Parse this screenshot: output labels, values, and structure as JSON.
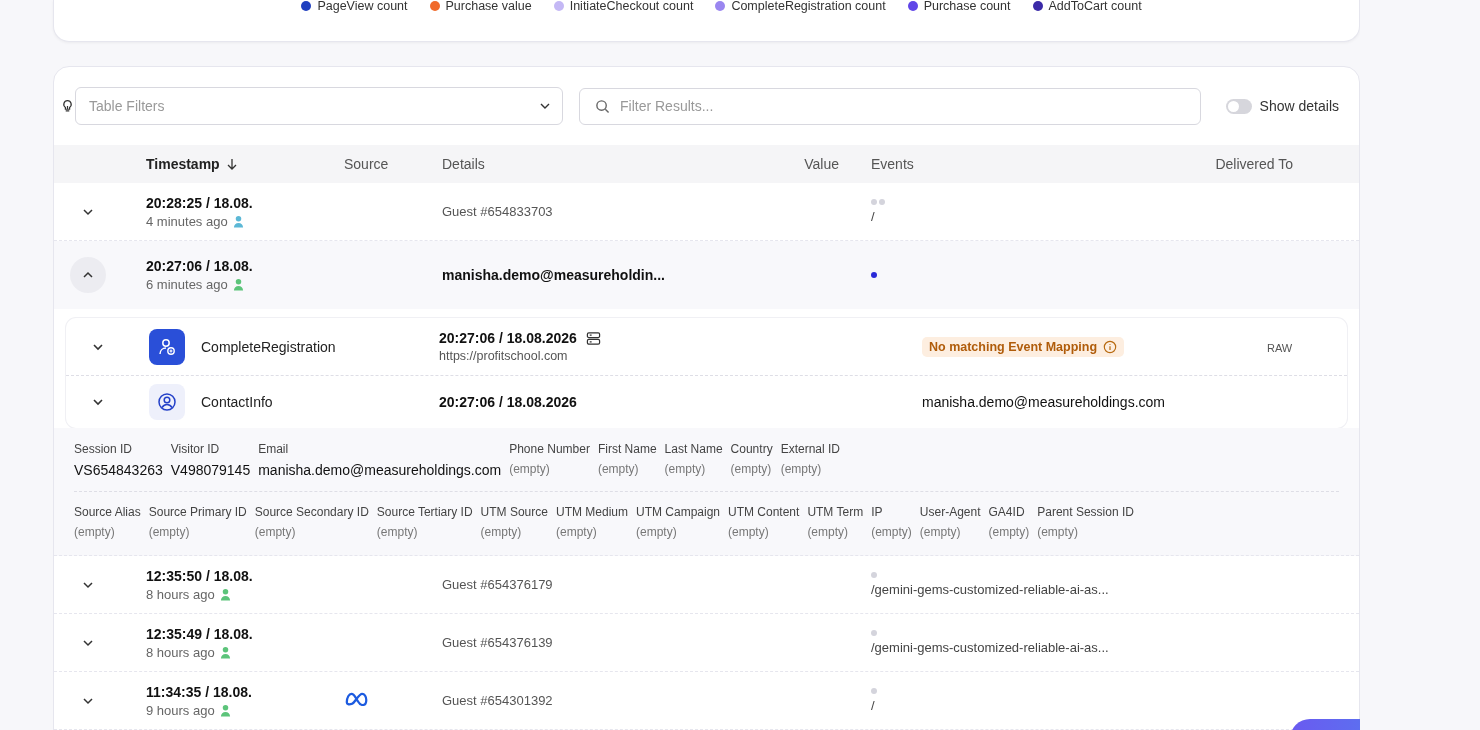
{
  "legend": [
    {
      "label": "PageView count",
      "color": "#1f3fbf"
    },
    {
      "label": "Purchase value",
      "color": "#f06a2b"
    },
    {
      "label": "InitiateCheckout count",
      "color": "#c4b8f5"
    },
    {
      "label": "CompleteRegistration count",
      "color": "#9a86f0"
    },
    {
      "label": "Purchase count",
      "color": "#6046e8"
    },
    {
      "label": "AddToCart count",
      "color": "#3b2aa8"
    }
  ],
  "filters": {
    "table_filters": {
      "placeholder": "Table Filters"
    },
    "search": {
      "placeholder": "Filter Results..."
    },
    "show_details": {
      "label": "Show details",
      "on": false
    }
  },
  "table": {
    "columns": [
      {
        "label": "Timestamp",
        "sorted": true
      },
      {
        "label": "Source",
        "sorted": false
      },
      {
        "label": "Details",
        "sorted": false
      },
      {
        "label": "Value",
        "sorted": false
      },
      {
        "label": "Events",
        "sorted": false
      },
      {
        "label": "Delivered To",
        "sorted": false
      }
    ],
    "rows": [
      {
        "time": "20:28:25 / 18.08.",
        "ago": "4 minutes ago",
        "color": "#5cb8d6",
        "source_logo": false,
        "details": "Guest #654833703",
        "details_bold": false,
        "events": [
          {
            "color": "#d4d4dc"
          },
          {
            "color": "#d4d4dc"
          }
        ],
        "path": "/",
        "expanded": false
      },
      {
        "time": "20:27:06 / 18.08.",
        "ago": "6 minutes ago",
        "color": "#5cc47a",
        "source_logo": false,
        "details": "manisha.demo@measureholdin...",
        "details_bold": true,
        "events": [
          {
            "color": "#2a2ad8"
          }
        ],
        "expanded": true,
        "children": [
          {
            "kind": "registration",
            "name": "CompleteRegistration",
            "time": "20:27:06 / 18.08.2026",
            "url": "https://profitschool.com",
            "badge": "No matching Event Mapping",
            "delivered": "RAW"
          },
          {
            "kind": "contact",
            "name": "ContactInfo",
            "time": "20:27:06 / 18.08.2026",
            "value": "manisha.demo@measureholdings.com"
          }
        ],
        "fields": [
          [
            {
              "label": "Session ID",
              "value": "VS654843263",
              "empty": false
            },
            {
              "label": "Visitor ID",
              "value": "V498079145",
              "empty": false
            },
            {
              "label": "Email",
              "value": "manisha.demo@measureholdings.com",
              "empty": false
            },
            {
              "label": "Phone Number",
              "value": "(empty)",
              "empty": true
            },
            {
              "label": "First Name",
              "value": "(empty)",
              "empty": true
            },
            {
              "label": "Last Name",
              "value": "(empty)",
              "empty": true
            },
            {
              "label": "Country",
              "value": "(empty)",
              "empty": true
            },
            {
              "label": "External ID",
              "value": "(empty)",
              "empty": true
            }
          ],
          [
            {
              "label": "Source Alias",
              "value": "(empty)",
              "empty": true
            },
            {
              "label": "Source Primary ID",
              "value": "(empty)",
              "empty": true
            },
            {
              "label": "Source Secondary ID",
              "value": "(empty)",
              "empty": true
            },
            {
              "label": "Source Tertiary ID",
              "value": "(empty)",
              "empty": true
            },
            {
              "label": "UTM Source",
              "value": "(empty)",
              "empty": true
            },
            {
              "label": "UTM Medium",
              "value": "(empty)",
              "empty": true
            },
            {
              "label": "UTM Campaign",
              "value": "(empty)",
              "empty": true
            },
            {
              "label": "UTM Content",
              "value": "(empty)",
              "empty": true
            },
            {
              "label": "UTM Term",
              "value": "(empty)",
              "empty": true
            },
            {
              "label": "IP",
              "value": "(empty)",
              "empty": true
            },
            {
              "label": "User-Agent",
              "value": "(empty)",
              "empty": true
            },
            {
              "label": "GA4ID",
              "value": "(empty)",
              "empty": true
            },
            {
              "label": "Parent Session ID",
              "value": "(empty)",
              "empty": true
            }
          ]
        ]
      },
      {
        "time": "12:35:50 / 18.08.",
        "ago": "8 hours ago",
        "color": "#5cc47a",
        "source_logo": false,
        "details": "Guest #654376179",
        "details_bold": false,
        "events": [
          {
            "color": "#d4d4dc"
          }
        ],
        "path": "/gemini-gems-customized-reliable-ai-as...",
        "expanded": false
      },
      {
        "time": "12:35:49 / 18.08.",
        "ago": "8 hours ago",
        "color": "#5cc47a",
        "source_logo": false,
        "details": "Guest #654376139",
        "details_bold": false,
        "events": [
          {
            "color": "#d4d4dc"
          }
        ],
        "path": "/gemini-gems-customized-reliable-ai-as...",
        "expanded": false
      },
      {
        "time": "11:34:35 / 18.08.",
        "ago": "9 hours ago",
        "color": "#5cc47a",
        "source_logo": true,
        "details": "Guest #654301392",
        "details_bold": false,
        "events": [
          {
            "color": "#d4d4dc"
          }
        ],
        "path": "/",
        "expanded": false
      }
    ]
  }
}
